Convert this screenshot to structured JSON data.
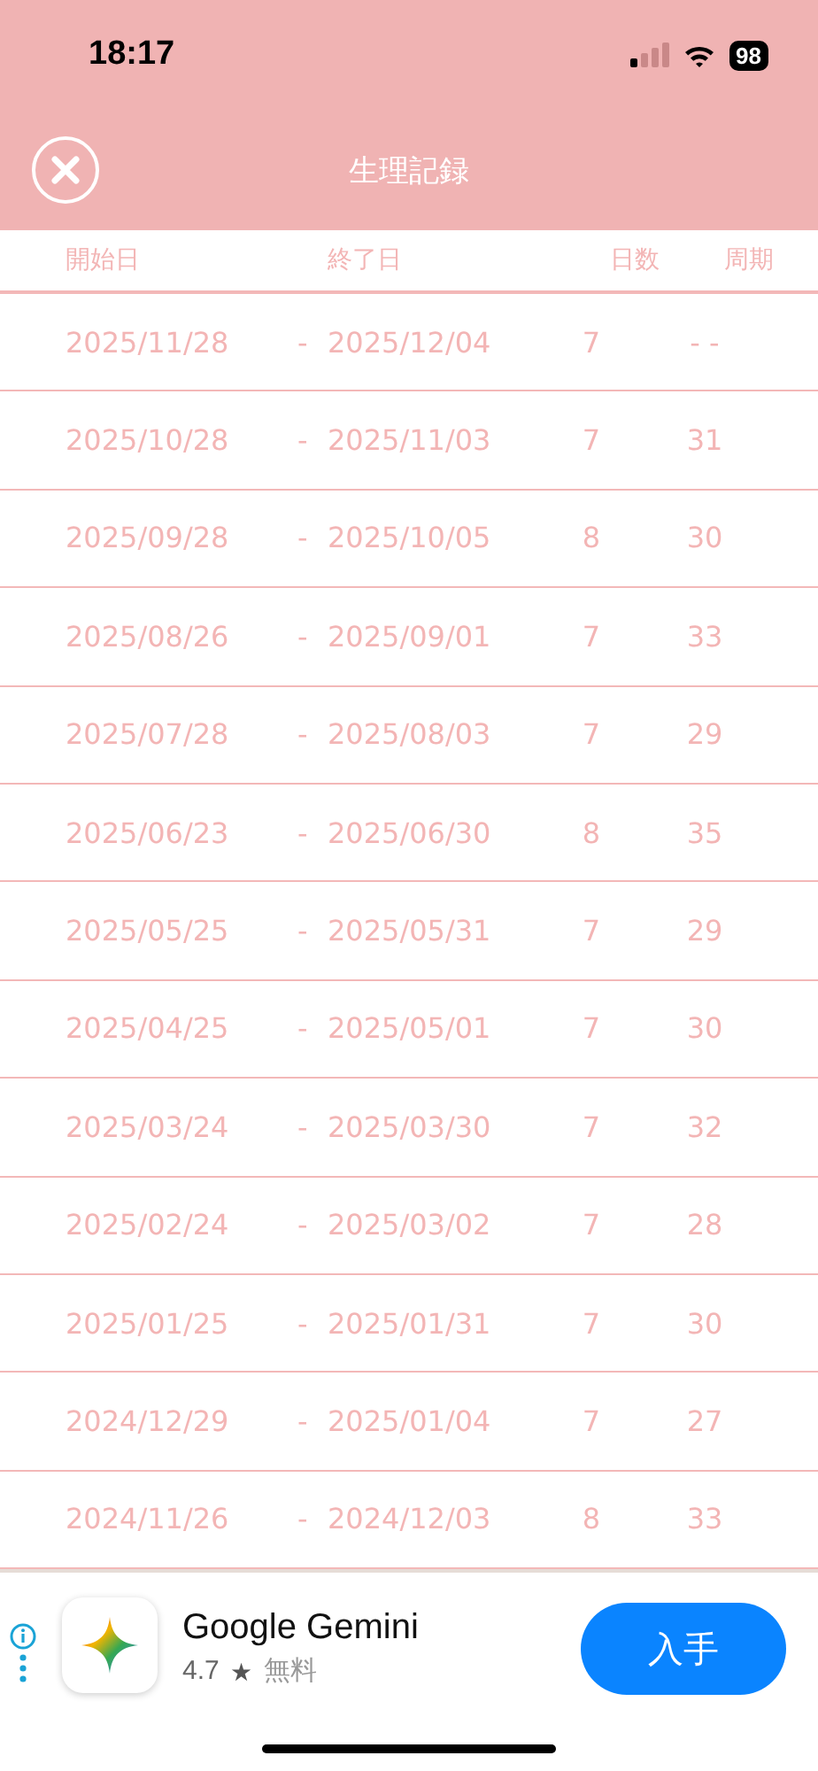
{
  "status_bar": {
    "time": "18:17",
    "battery": "98"
  },
  "header": {
    "title": "生理記録"
  },
  "table": {
    "columns": [
      "開始日",
      "終了日",
      "日数",
      "周期"
    ],
    "rows": [
      {
        "start": "2025/11/28",
        "separator": "-",
        "end": "2025/12/04",
        "days": "7",
        "cycle": "- -"
      },
      {
        "start": "2025/10/28",
        "separator": "-",
        "end": "2025/11/03",
        "days": "7",
        "cycle": "31"
      },
      {
        "start": "2025/09/28",
        "separator": "-",
        "end": "2025/10/05",
        "days": "8",
        "cycle": "30"
      },
      {
        "start": "2025/08/26",
        "separator": "-",
        "end": "2025/09/01",
        "days": "7",
        "cycle": "33"
      },
      {
        "start": "2025/07/28",
        "separator": "-",
        "end": "2025/08/03",
        "days": "7",
        "cycle": "29"
      },
      {
        "start": "2025/06/23",
        "separator": "-",
        "end": "2025/06/30",
        "days": "8",
        "cycle": "35"
      },
      {
        "start": "2025/05/25",
        "separator": "-",
        "end": "2025/05/31",
        "days": "7",
        "cycle": "29"
      },
      {
        "start": "2025/04/25",
        "separator": "-",
        "end": "2025/05/01",
        "days": "7",
        "cycle": "30"
      },
      {
        "start": "2025/03/24",
        "separator": "-",
        "end": "2025/03/30",
        "days": "7",
        "cycle": "32"
      },
      {
        "start": "2025/02/24",
        "separator": "-",
        "end": "2025/03/02",
        "days": "7",
        "cycle": "28"
      },
      {
        "start": "2025/01/25",
        "separator": "-",
        "end": "2025/01/31",
        "days": "7",
        "cycle": "30"
      },
      {
        "start": "2024/12/29",
        "separator": "-",
        "end": "2025/01/04",
        "days": "7",
        "cycle": "27"
      },
      {
        "start": "2024/11/26",
        "separator": "-",
        "end": "2024/12/03",
        "days": "8",
        "cycle": "33"
      }
    ]
  },
  "ad": {
    "app_name": "Google Gemini",
    "rating": "4.7",
    "star": "★",
    "price": "無料",
    "button": "入手"
  }
}
